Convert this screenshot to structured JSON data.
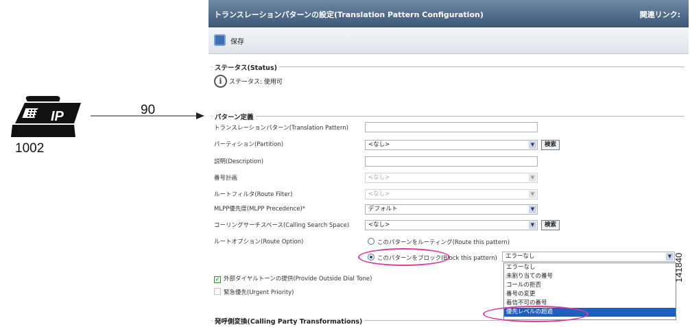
{
  "diagram": {
    "phone_label": "IP",
    "extension": "1002",
    "dialed_number": "90"
  },
  "window": {
    "title": "トランスレーションパターンの設定(Translation Pattern Configuration)",
    "related_links": "関連リンク:"
  },
  "toolbar": {
    "save_label": "保存"
  },
  "status": {
    "legend": "ステータス(Status)",
    "icon": "info-icon",
    "text": "ステータス: 使用可"
  },
  "pattern_def": {
    "legend": "パターン定義",
    "fields": {
      "translation_pattern": {
        "label": "トランスレーションパターン(Translation Pattern)",
        "value": ""
      },
      "partition": {
        "label": "パーティション(Partition)",
        "value": "<なし>",
        "button": "検索"
      },
      "description": {
        "label": "説明(Description)",
        "value": ""
      },
      "numbering_plan": {
        "label": "番号計画",
        "value": "<なし>"
      },
      "route_filter": {
        "label": "ルートフィルタ(Route Filter)",
        "value": "<なし>"
      },
      "mlpp": {
        "label": "MLPP優先度(MLPP Precedence)*",
        "value": "デフォルト"
      },
      "css": {
        "label": "コーリングサーチスペース(Calling Search Space)",
        "value": "<なし>",
        "button": "検索"
      },
      "route_option": {
        "label": "ルートオプション(Route Option)",
        "route": "このパターンをルーティング(Route this pattern)",
        "block": "このパターンをブロック(Block this pattern)",
        "block_reason": "エラーなし"
      },
      "outside_dial_tone": {
        "label": "外部ダイヤルトーンの提供(Provide Outside Dial Tone)",
        "checked": true
      },
      "urgent_priority": {
        "label": "緊急優先(Urgent Priority)",
        "checked": false
      }
    },
    "reason_options": [
      "エラーなし",
      "未割り当ての番号",
      "コールの拒否",
      "番号の変更",
      "着信不可の番号",
      "優先レベルの超過"
    ],
    "selected_reason_index": 5
  },
  "calling_party": {
    "legend": "発呼側変換(Calling Party Transformations)"
  },
  "figure_id": "141840",
  "colors": {
    "title_bar": "#4a6585",
    "highlight_ring": "#d83ba3",
    "selected_option": "#1f5fbf"
  }
}
